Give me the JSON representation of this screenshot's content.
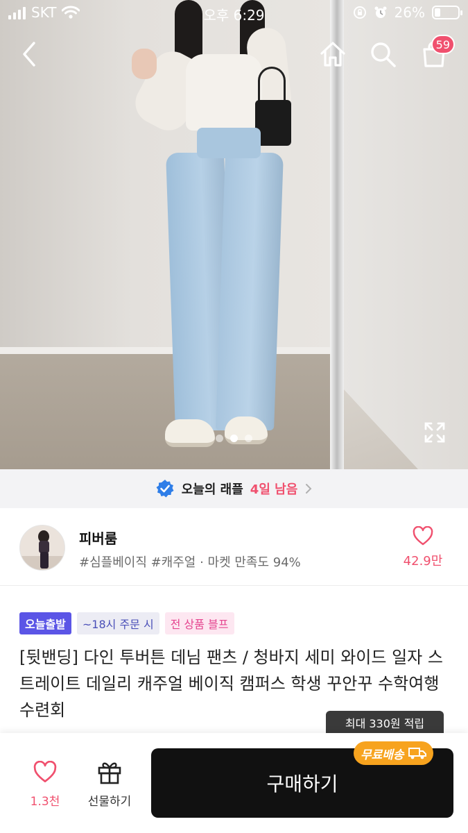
{
  "status_bar": {
    "carrier": "SKT",
    "time": "오후 6:29",
    "battery": "26%",
    "battery_level": 0.26
  },
  "top_nav": {
    "cart_count": "59"
  },
  "gallery": {
    "image_count": 3,
    "active_index": 1
  },
  "raffle": {
    "label": "오늘의 래플",
    "remaining": "4일 남음"
  },
  "shop": {
    "name": "피버룸",
    "tags": "#심플베이직 #캐주얼 · 마켓 만족도 94%",
    "like_count": "42.9만"
  },
  "product": {
    "badges": [
      "오늘출발",
      "~18시 주문 시",
      "전 상품 블프"
    ],
    "title": "[뒷밴딩] 다인 투버튼 데님 팬츠 / 청바지 세미 와이드 일자 스트레이트 데일리 캐주얼 베이직 캠퍼스 학생 꾸안꾸 수학여행 수련회",
    "points_tooltip": "최대 330원 적립"
  },
  "bottom_bar": {
    "like_count": "1.3천",
    "gift_label": "선물하기",
    "buy_label": "구매하기",
    "free_shipping": "무료배송"
  },
  "colors": {
    "accent_pink": "#f0506e",
    "badge_purple": "#5b55e6",
    "buy_button": "#111111",
    "free_shipping": "#f7a31e"
  }
}
